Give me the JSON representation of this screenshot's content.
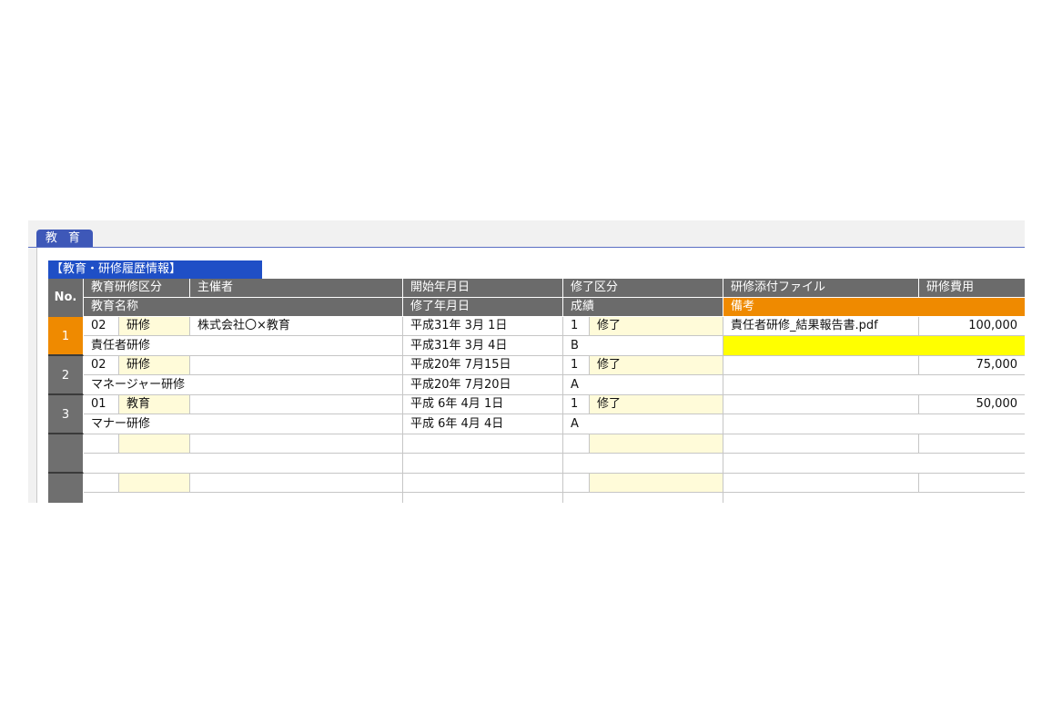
{
  "tab": {
    "label": "教 育"
  },
  "section": {
    "title": "【教育・研修履歴情報】"
  },
  "headers": {
    "no": "No.",
    "category": "教育研修区分",
    "organizer": "主催者",
    "start_date": "開始年月日",
    "completion_type": "修了区分",
    "attachment": "研修添付ファイル",
    "cost": "研修費用",
    "name": "教育名称",
    "end_date": "修了年月日",
    "grade": "成績",
    "remarks": "備考"
  },
  "colors": {
    "header_gray": "#6b6b6b",
    "accent_orange": "#ef8a00",
    "tab_blue": "#3e58b8",
    "title_blue": "#1f4fc6",
    "highlight_yellow": "#ffff00"
  },
  "rows": [
    {
      "no": "1",
      "code": "02",
      "category": "研修",
      "organizer": "株式会社〇×教育",
      "start": "平成31年  3月  1日",
      "comp_code": "1",
      "comp": "修了",
      "file": "責任者研修_結果報告書.pdf",
      "cost": "100,000",
      "name": "責任者研修",
      "end": "平成31年  3月  4日",
      "grade": "B",
      "remarks": ""
    },
    {
      "no": "2",
      "code": "02",
      "category": "研修",
      "organizer": "",
      "start": "平成20年  7月15日",
      "comp_code": "1",
      "comp": "修了",
      "file": "",
      "cost": "75,000",
      "name": "マネージャー研修",
      "end": "平成20年  7月20日",
      "grade": "A",
      "remarks": ""
    },
    {
      "no": "3",
      "code": "01",
      "category": "教育",
      "organizer": "",
      "start": "平成  6年  4月  1日",
      "comp_code": "1",
      "comp": "修了",
      "file": "",
      "cost": "50,000",
      "name": "マナー研修",
      "end": "平成  6年  4月  4日",
      "grade": "A",
      "remarks": ""
    },
    {
      "no": "",
      "code": "",
      "category": "",
      "organizer": "",
      "start": "",
      "comp_code": "",
      "comp": "",
      "file": "",
      "cost": "",
      "name": "",
      "end": "",
      "grade": "",
      "remarks": ""
    },
    {
      "no": "",
      "code": "",
      "category": "",
      "organizer": "",
      "start": "",
      "comp_code": "",
      "comp": "",
      "file": "",
      "cost": "",
      "name": "",
      "end": "",
      "grade": "",
      "remarks": ""
    }
  ]
}
